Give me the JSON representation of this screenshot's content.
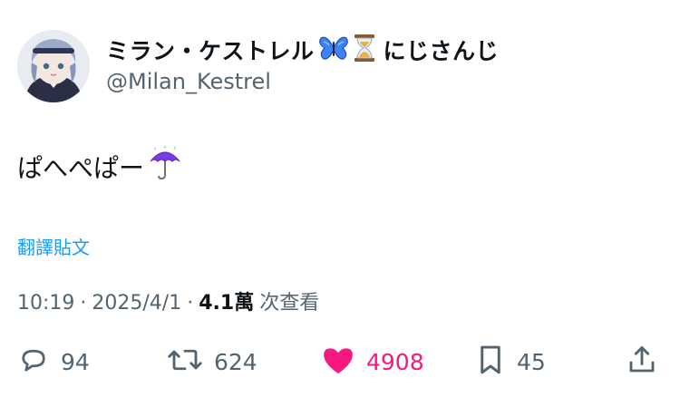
{
  "author": {
    "display_name": "ミラン・ケストレル",
    "name_emojis": [
      "butterfly-emoji",
      "hourglass-emoji"
    ],
    "affiliation": "にじさんじ",
    "handle": "@Milan_Kestrel"
  },
  "tweet": {
    "text": "ぱへぺぱー",
    "text_emoji": "umbrella-with-rain-drops-emoji"
  },
  "translate_label": "翻譯貼文",
  "meta": {
    "time": "10:19",
    "separator": "·",
    "date": "2025/4/1",
    "views_count": "4.1萬",
    "views_label": "次查看"
  },
  "actions": {
    "replies": "94",
    "reposts": "624",
    "likes": "4908",
    "bookmarks": "45"
  },
  "colors": {
    "text": "#0f1419",
    "muted": "#536471",
    "link": "#1d9bf0",
    "like": "#f91880"
  }
}
